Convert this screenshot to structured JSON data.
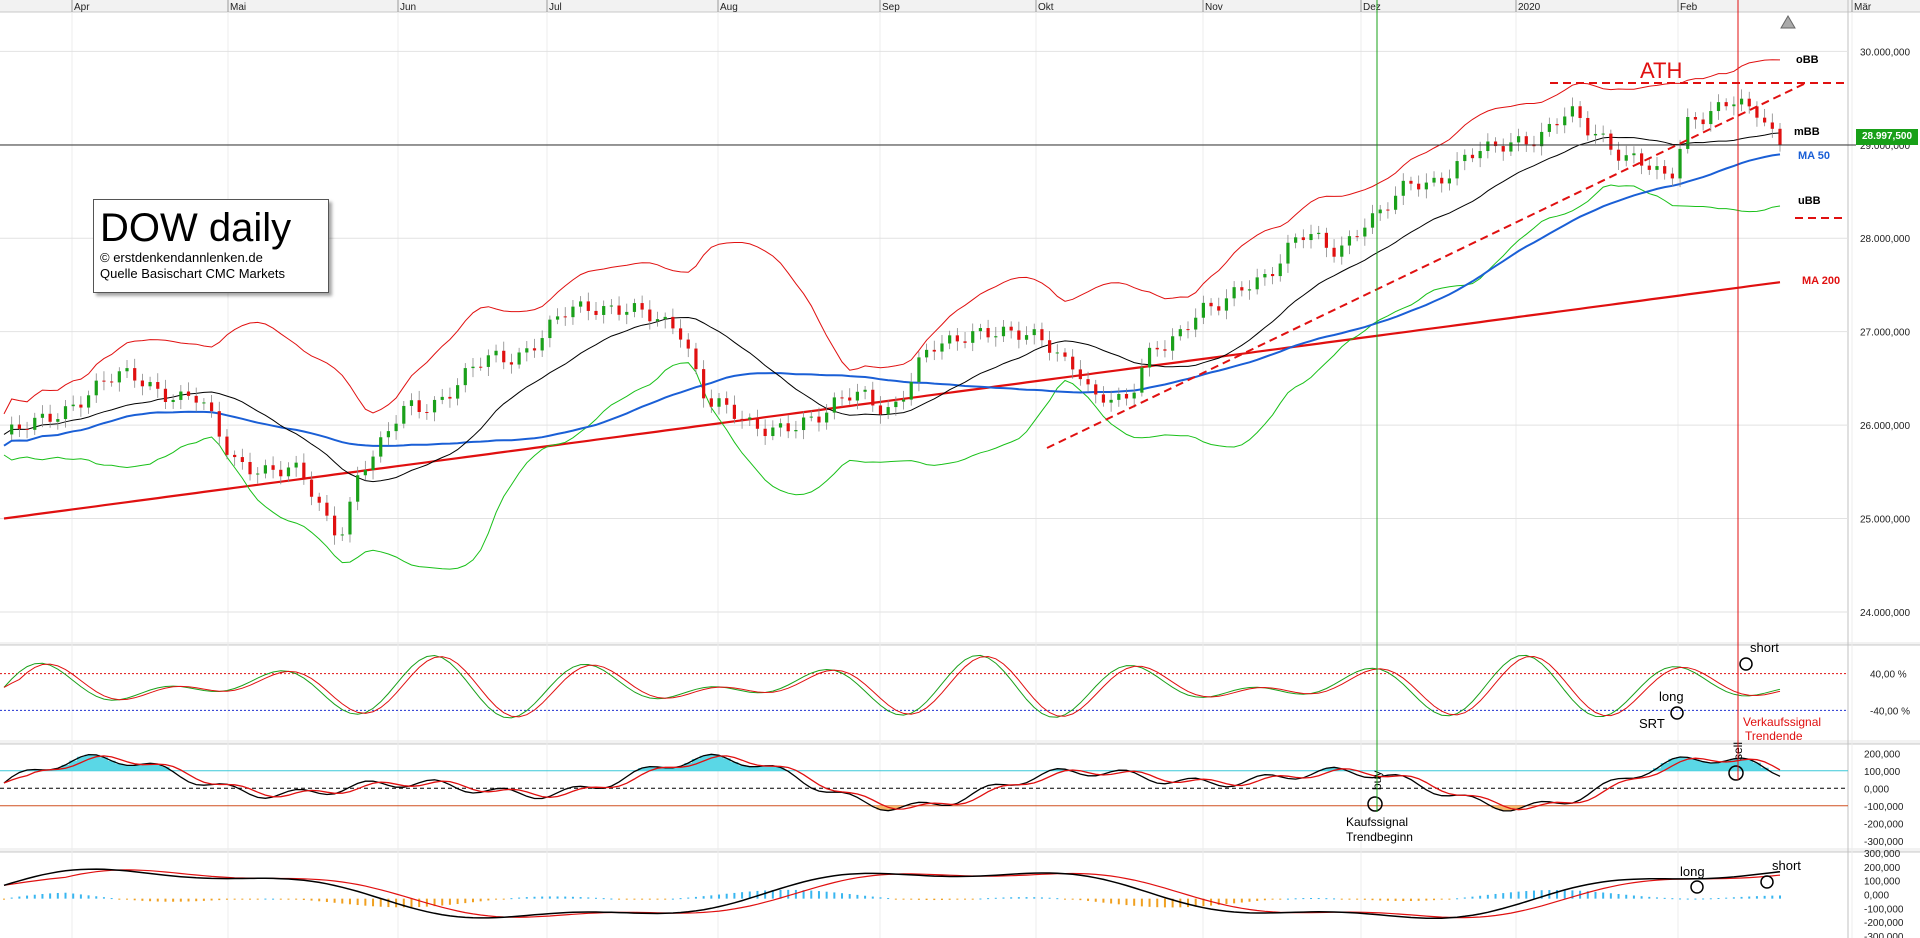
{
  "chart_data": [
    {
      "type": "candlestick",
      "title": "DOW daily",
      "subtitle": [
        "© erstdenkendannlenken.de",
        "Quelle Basischart CMC Markets"
      ],
      "x_ticks": [
        "Apr",
        "Mai",
        "Jun",
        "Jul",
        "Aug",
        "Sep",
        "Okt",
        "Nov",
        "Dez",
        "2020",
        "Feb",
        "Mär"
      ],
      "y_ticks": [
        "30.000,000",
        "29.000,000",
        "28.000,000",
        "27.000,000",
        "26.000,000",
        "25.000,000",
        "24.000,000"
      ],
      "ylim": [
        23700,
        30400
      ],
      "current_price_label": "28.997,500",
      "current_price": 28997.5,
      "series": [
        {
          "name": "oBB",
          "color": "#e01010"
        },
        {
          "name": "mBB",
          "color": "#000000"
        },
        {
          "name": "MA 50",
          "color": "#1a5fd6"
        },
        {
          "name": "uBB",
          "color": "#19c019"
        },
        {
          "name": "MA 200",
          "color": "#e01010"
        }
      ],
      "annotations": [
        "ATH",
        "oBB",
        "mBB",
        "MA 50",
        "uBB",
        "MA 200"
      ],
      "grid": true
    },
    {
      "type": "line",
      "name": "stochastic",
      "y_ticks": [
        "40,00 %",
        "-40,00 %"
      ],
      "annotations": [
        "short",
        "long",
        "SRT",
        "Verkaufssignal",
        "Trendende"
      ]
    },
    {
      "type": "area",
      "name": "oscillator",
      "y_ticks": [
        "200,000",
        "100,000",
        "0,000",
        "-100,000",
        "-200,000",
        "-300,000"
      ],
      "annotations": [
        "buy",
        "sell",
        "Kaufssignal",
        "Trendbeginn"
      ]
    },
    {
      "type": "bar",
      "name": "macd",
      "y_ticks": [
        "300,000",
        "200,000",
        "100,000",
        "0,000",
        "-100,000",
        "-200,000",
        "-300,000"
      ],
      "annotations": [
        "long",
        "short"
      ]
    }
  ],
  "colors": {
    "up": "#1aa01a",
    "down": "#e01010",
    "grid": "#e2e2e2",
    "stoch_upper": "#e01010",
    "stoch_lower": "#2030d0",
    "osc_pos_fill": "#5ad7e6",
    "osc_neg_fill": "#f5b86a",
    "macd_pos": "#38b6f0",
    "macd_neg": "#f0a020"
  }
}
